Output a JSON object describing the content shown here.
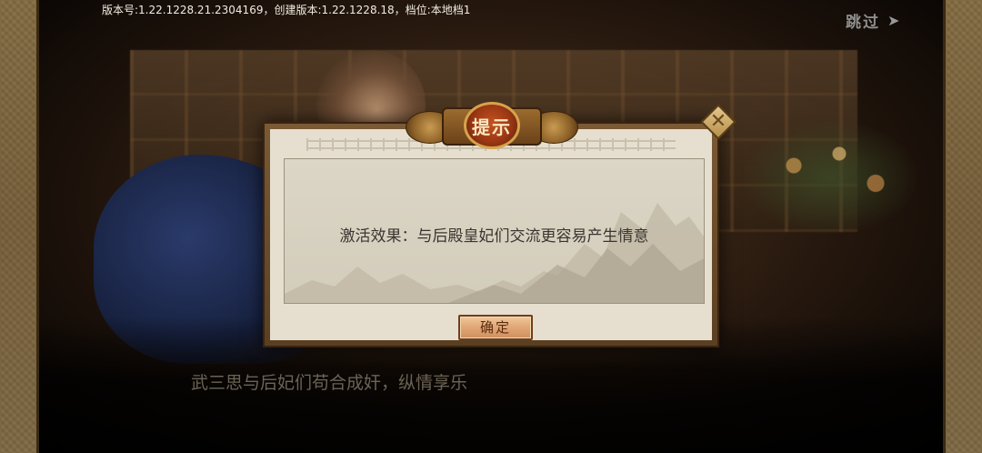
{
  "top_bar": {
    "version_text": "版本号:1.22.1228.21.2304169，创建版本:1.22.1228.18，档位:本地档1",
    "skip_label": "跳过",
    "skip_icon": "arrow-right-icon"
  },
  "story": {
    "subtitle": "武三思与后妃们苟合成奸，纵情享乐"
  },
  "dialog": {
    "title": "提示",
    "message": "激活效果：与后殿皇妃们交流更容易产生情意",
    "confirm_label": "确定",
    "close_icon": "close-icon"
  },
  "colors": {
    "frame": "#7d6540",
    "dialog_bg": "#e6dfcf",
    "title_medallion": "#9a3714",
    "confirm_button": "#e2a877"
  }
}
